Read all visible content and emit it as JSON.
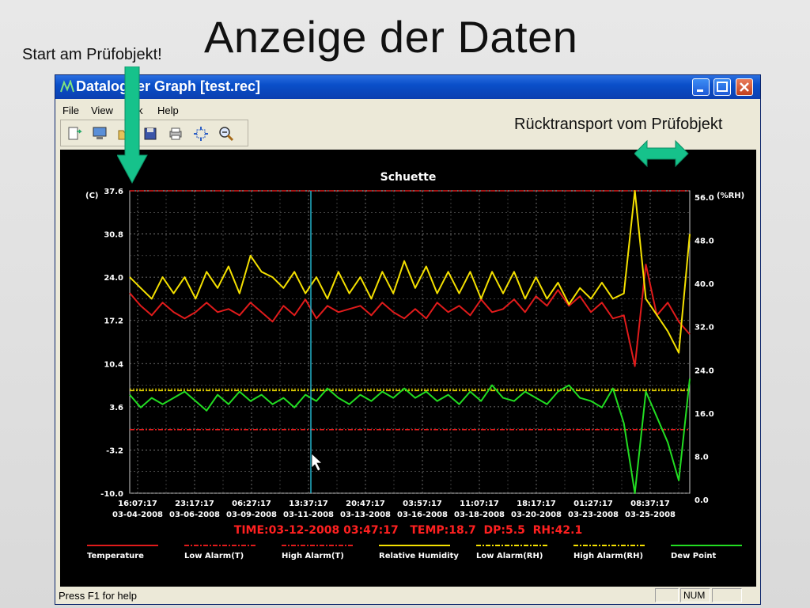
{
  "slide": {
    "title": "Anzeige der Daten",
    "note_start": "Start am Prüfobjekt!",
    "note_return": "Rücktransport vom Prüfobjekt"
  },
  "window": {
    "title": "Datalogger Graph [test.rec]",
    "menu": [
      "File",
      "View",
      "k",
      "Help"
    ],
    "status": "Press F1 for help",
    "status_num": "NUM"
  },
  "colors": {
    "temperature": "#e01b1b",
    "humidity": "#f4e000",
    "dew_point": "#22dd22",
    "cursor": "#23b0c8",
    "arrow": "#16c28b"
  },
  "chart_data": {
    "type": "line",
    "title": "Schuette",
    "ylabel_left": "(C)",
    "ylabel_right": "(%RH)",
    "y_left_ticks": [
      "37.6",
      "30.8",
      "24.0",
      "17.2",
      "10.4",
      "3.6",
      "-3.2",
      "-10.0"
    ],
    "y_right_ticks": [
      "56.0",
      "48.0",
      "40.0",
      "32.0",
      "24.0",
      "16.0",
      "8.0",
      "0.0"
    ],
    "ylim_left": [
      -10.0,
      37.6
    ],
    "ylim_right": [
      0.0,
      56.0
    ],
    "x_ticks": [
      {
        "time": "16:07:17",
        "date": "03-04-2008"
      },
      {
        "time": "23:17:17",
        "date": "03-06-2008"
      },
      {
        "time": "06:27:17",
        "date": "03-09-2008"
      },
      {
        "time": "13:37:17",
        "date": "03-11-2008"
      },
      {
        "time": "20:47:17",
        "date": "03-13-2008"
      },
      {
        "time": "03:57:17",
        "date": "03-16-2008"
      },
      {
        "time": "11:07:17",
        "date": "03-18-2008"
      },
      {
        "time": "18:17:17",
        "date": "03-20-2008"
      },
      {
        "time": "01:27:17",
        "date": "03-23-2008"
      },
      {
        "time": "08:37:17",
        "date": "03-25-2008"
      }
    ],
    "readout": "TIME:03-12-2008 03:47:17   TEMP:18.7  DP:5.5  RH:42.1",
    "alarms": {
      "high_t": 37.6,
      "low_t": 0.0,
      "low_rh": 19.0,
      "high_rh": 19.0
    },
    "legend": [
      {
        "label": "Temperature",
        "color": "#e01b1b",
        "style": "solid"
      },
      {
        "label": "Low Alarm(T)",
        "color": "#e01b1b",
        "style": "dashdot"
      },
      {
        "label": "High Alarm(T)",
        "color": "#e01b1b",
        "style": "dashdot"
      },
      {
        "label": "Relative Humidity",
        "color": "#f4e000",
        "style": "solid"
      },
      {
        "label": "Low Alarm(RH)",
        "color": "#f4e000",
        "style": "dashdot"
      },
      {
        "label": "High Alarm(RH)",
        "color": "#f4e000",
        "style": "dashdot"
      },
      {
        "label": "Dew Point",
        "color": "#22dd22",
        "style": "solid"
      }
    ],
    "series": [
      {
        "name": "Temperature",
        "axis": "left",
        "values": [
          21.5,
          19.5,
          18.0,
          20.0,
          18.5,
          17.5,
          18.5,
          20.0,
          18.5,
          19.0,
          18.0,
          20.0,
          18.5,
          17.0,
          19.5,
          18.0,
          20.5,
          17.5,
          19.5,
          18.5,
          19.0,
          19.5,
          18.0,
          20.0,
          18.5,
          17.5,
          19.0,
          17.5,
          20.0,
          18.5,
          19.5,
          18.0,
          20.5,
          18.5,
          19.0,
          20.5,
          18.5,
          21.0,
          19.5,
          22.0,
          19.5,
          21.0,
          18.5,
          20.0,
          17.5,
          18.0,
          10.0,
          26.0,
          18.0,
          20.0,
          17.0,
          15.0
        ]
      },
      {
        "name": "Relative Humidity",
        "axis": "right",
        "values": [
          40.0,
          38.0,
          36.0,
          40.0,
          37.0,
          40.0,
          36.0,
          41.0,
          38.0,
          42.0,
          37.0,
          44.0,
          41.0,
          40.0,
          38.0,
          41.0,
          37.0,
          40.0,
          36.0,
          41.0,
          37.0,
          40.0,
          36.0,
          41.0,
          37.0,
          43.0,
          38.0,
          42.0,
          37.0,
          41.0,
          37.0,
          41.0,
          36.0,
          41.0,
          37.0,
          41.0,
          36.0,
          40.0,
          36.0,
          39.0,
          35.0,
          38.0,
          36.0,
          39.0,
          36.0,
          37.0,
          56.0,
          36.0,
          33.0,
          30.0,
          26.0,
          48.0
        ]
      },
      {
        "name": "Dew Point",
        "axis": "left",
        "values": [
          5.5,
          3.5,
          5.0,
          4.0,
          5.0,
          6.0,
          4.5,
          3.0,
          5.5,
          4.0,
          6.0,
          4.5,
          5.5,
          4.0,
          5.0,
          3.5,
          5.5,
          4.5,
          6.5,
          5.0,
          4.0,
          5.5,
          4.5,
          6.0,
          5.0,
          6.5,
          5.0,
          6.0,
          4.5,
          5.5,
          4.0,
          6.0,
          4.5,
          7.0,
          5.0,
          4.5,
          6.0,
          5.0,
          4.0,
          6.0,
          7.0,
          5.0,
          4.5,
          3.5,
          6.5,
          1.0,
          -10.0,
          6.0,
          2.0,
          -2.0,
          -8.0,
          8.0
        ]
      }
    ]
  }
}
